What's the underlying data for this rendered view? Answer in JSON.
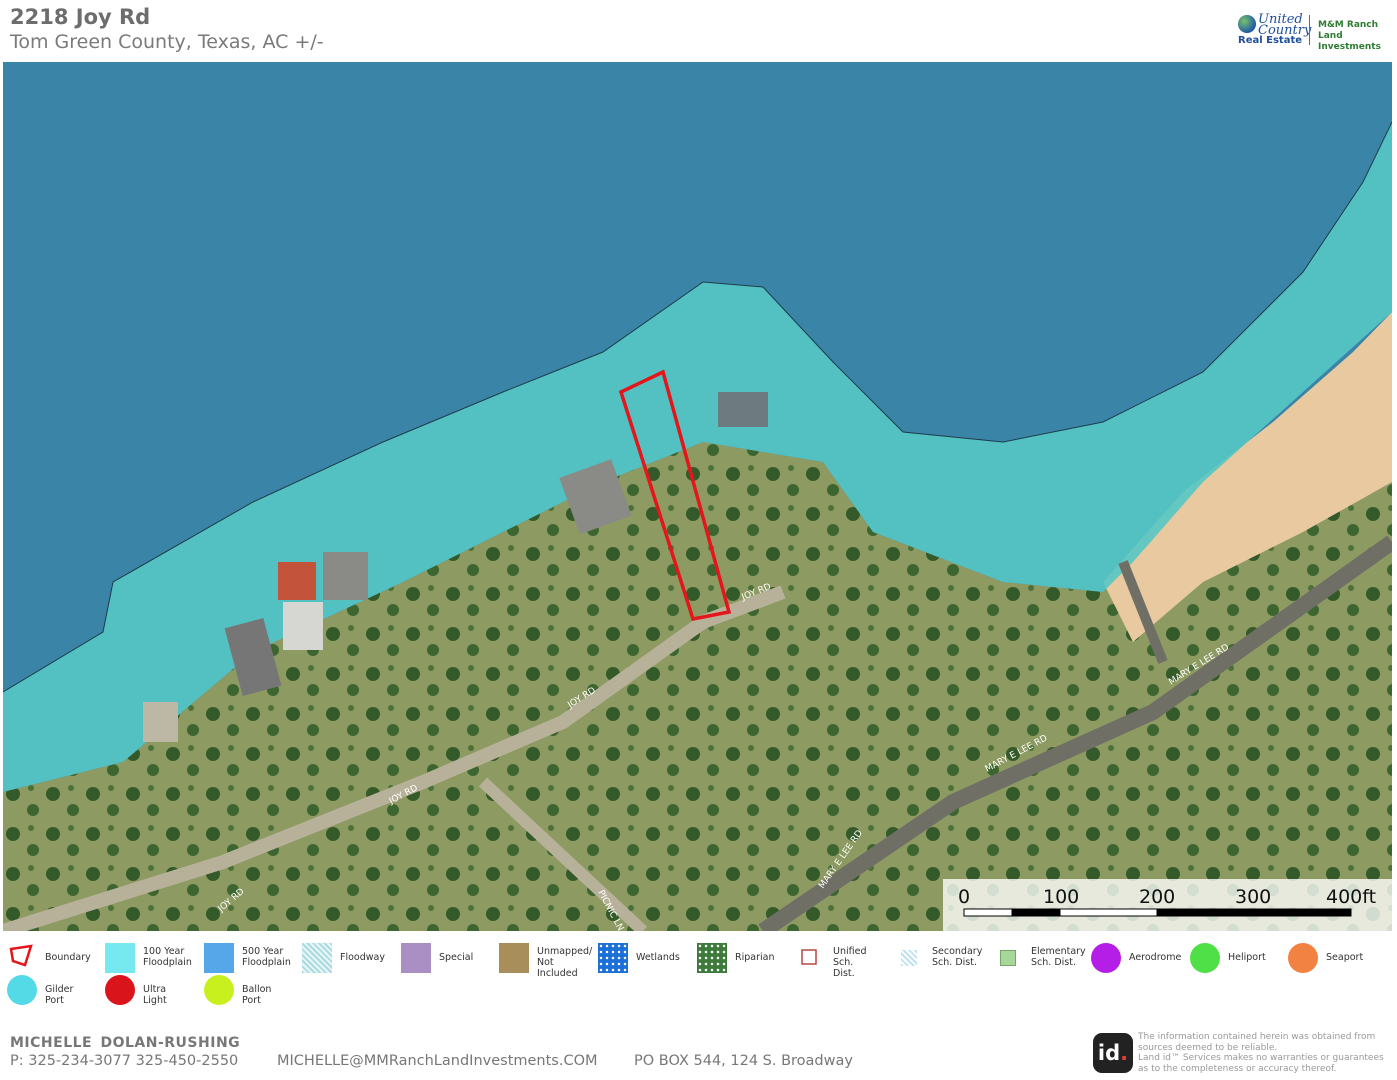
{
  "header": {
    "title": "2218 Joy Rd",
    "subtitle": "Tom Green County, Texas,  AC +/-"
  },
  "brand": {
    "united_country_line1": "United",
    "united_country_line2": "Country",
    "real_estate": "Real Estate",
    "partner_line1": "M&M Ranch",
    "partner_line2": "Land Investments"
  },
  "map": {
    "layer_colors": {
      "water": "#3a84a8",
      "floodplain_100yr": "#56c7c4",
      "shore_floodplain": "#6ad4cf",
      "land": "#8c9a5c",
      "beach": "#e8c9a0",
      "boundary": "#e5161b"
    },
    "road_labels": [
      "JOY RD",
      "JOY RD",
      "JOY RD",
      "JOY RD",
      "MARY E LEE RD",
      "MARY E LEE RD",
      "MARY E LEE RD",
      "PICNIC LN"
    ],
    "scale_bar": {
      "ticks": [
        "0",
        "100",
        "200",
        "300",
        "400ft"
      ]
    }
  },
  "legend": {
    "items": [
      {
        "label": "Boundary",
        "icon": "boundary-outline-icon",
        "color": "#e5161b"
      },
      {
        "label": "100 Year\nFloodplain",
        "icon": "floodplain-100-swatch",
        "color": "#76e8ef"
      },
      {
        "label": "500 Year\nFloodplain",
        "icon": "floodplain-500-swatch",
        "color": "#55a7e9"
      },
      {
        "label": "Floodway",
        "icon": "floodway-swatch",
        "color": "#a9dbe0"
      },
      {
        "label": "Special",
        "icon": "special-swatch",
        "color": "#a98fc4"
      },
      {
        "label": "Unmapped/\nNot Included",
        "icon": "unmapped-swatch",
        "color": "#a88e5a"
      },
      {
        "label": "Wetlands",
        "icon": "wetlands-swatch",
        "color": "#1b6fd6"
      },
      {
        "label": "Riparian",
        "icon": "riparian-swatch",
        "color": "#3e7b3a"
      },
      {
        "label": "Unified Sch.\nDist.",
        "icon": "unified-school-district-swatch",
        "color": "#b94646"
      },
      {
        "label": "Secondary\nSch. Dist.",
        "icon": "secondary-school-district-swatch",
        "color": "#bfe1ee"
      },
      {
        "label": "Elementary\nSch. Dist.",
        "icon": "elementary-school-district-swatch",
        "color": "#a5d79a"
      },
      {
        "label": "Aerodrome",
        "icon": "aerodrome-icon",
        "color": "#b51ee6"
      },
      {
        "label": "Heliport",
        "icon": "heliport-icon",
        "color": "#4fe048"
      },
      {
        "label": "Seaport",
        "icon": "seaport-icon",
        "color": "#f28242"
      },
      {
        "label": "Gilder Port",
        "icon": "glider-port-icon",
        "color": "#54d9e6"
      },
      {
        "label": "Ultra Light",
        "icon": "ultra-light-icon",
        "color": "#d9141a"
      },
      {
        "label": "Ballon Port",
        "icon": "balloon-port-icon",
        "color": "#c7f01e"
      }
    ]
  },
  "footer": {
    "agent_name": "MICHELLE  DOLAN-RUSHING",
    "phone": "P: 325-234-3077 325-450-2550",
    "email": "MICHELLE@MMRanchLandInvestments.COM",
    "address": "PO BOX 544, 124 S. Broadway",
    "id_logo_text": "id",
    "disclaimer": "The information contained herein was obtained from sources deemed to be reliable.\nLand id™ Services makes no warranties or guarantees as to the completeness or accuracy thereof."
  }
}
